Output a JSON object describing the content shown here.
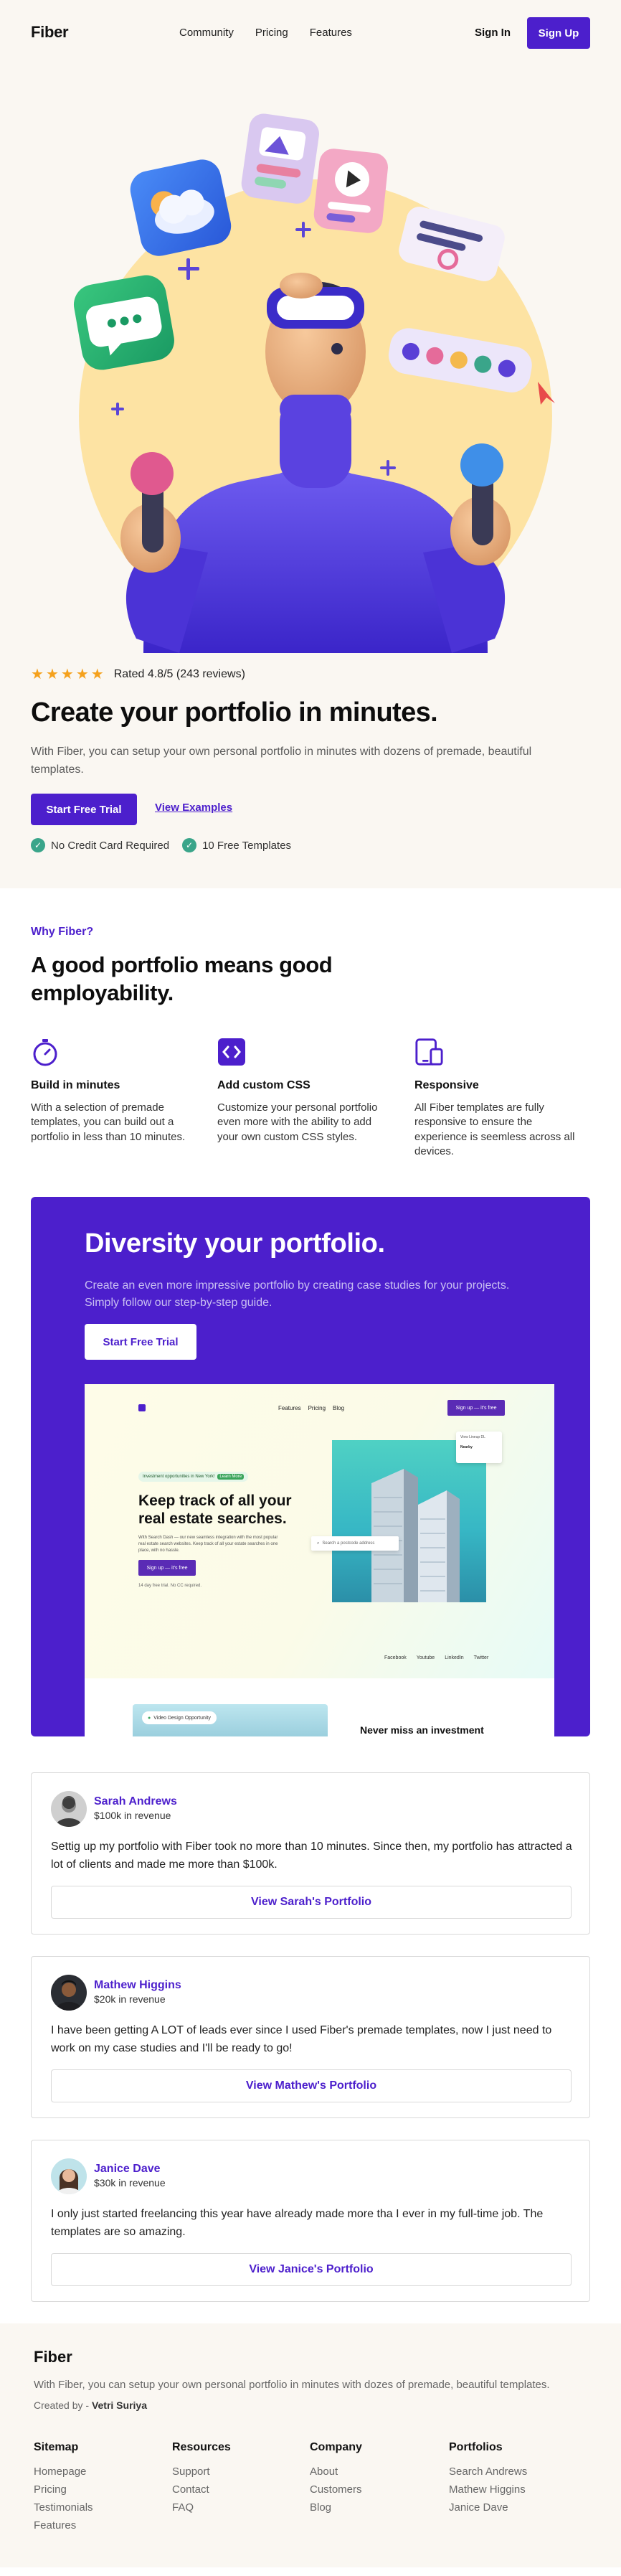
{
  "nav": {
    "logo": "Fiber",
    "links": [
      "Community",
      "Pricing",
      "Features"
    ],
    "sign_in": "Sign In",
    "sign_up": "Sign Up"
  },
  "hero": {
    "stars": 5,
    "rating_text": "Rated 4.8/5 (243 reviews)",
    "title": "Create your portfolio in minutes.",
    "description": "With Fiber, you can setup your own personal portfolio in minutes with dozens of premade, beautiful templates.",
    "primary_button": "Start Free Trial",
    "secondary_link": "View Examples",
    "checks": [
      "No Credit Card Required",
      "10 Free Templates"
    ]
  },
  "why": {
    "eyebrow": "Why Fiber?",
    "title": "A good portfolio means good employability.",
    "features": [
      {
        "title": "Build in minutes",
        "description": "With a selection of premade templates, you can build out a portfolio in less than 10 minutes.",
        "icon": "stopwatch-icon"
      },
      {
        "title": "Add custom CSS",
        "description": "Customize your personal portfolio even more with the ability to add your own custom CSS styles.",
        "icon": "code-icon"
      },
      {
        "title": "Responsive",
        "description": "All Fiber templates are fully responsive to ensure the experience is seemless across all devices.",
        "icon": "devices-icon"
      }
    ]
  },
  "diversity": {
    "title": "Diversity your portfolio.",
    "description": "Create an even more impressive portfolio by creating case studies for your projects. Simply follow our step-by-step guide.",
    "button": "Start Free Trial",
    "mockup": {
      "nav": [
        "Features",
        "Pricing",
        "Blog"
      ],
      "sign_up": "Sign up — it's free",
      "pill_text": "Investment opportunities in New York!",
      "pill_tag": "Learn More",
      "heading": "Keep track of all your real estate searches.",
      "paragraph": "With Search Dash — our new seamless integration with the most popular real estate search websites. Keep track of all your estate searches in one place, with no hassle.",
      "button": "Sign up — it's free",
      "note": "14 day free trial. No CC required.",
      "search_placeholder": "Search a postcode address",
      "float_line1": "View Lineup DL",
      "float_line2": "Nearby",
      "social": [
        "Facebook",
        "Youtube",
        "LinkedIn",
        "Twitter"
      ],
      "bottom_pill": "Video Design Opportunity",
      "bottom_heading": "Never miss an investment"
    }
  },
  "testimonials": [
    {
      "name": "Sarah Andrews",
      "revenue": "$100k in revenue",
      "quote": "Settig up my portfolio with Fiber took no more than 10 minutes. Since then, my portfolio has attracted a lot of clients and made me more than $100k.",
      "button": "View Sarah's Portfolio"
    },
    {
      "name": "Mathew Higgins",
      "revenue": "$20k in revenue",
      "quote": "I have been getting A LOT of leads ever since I used Fiber's premade templates, now I just need to work on my case studies and I'll be ready to go!",
      "button": "View Mathew's Portfolio"
    },
    {
      "name": "Janice Dave",
      "revenue": "$30k in revenue",
      "quote": "I only just started freelancing this year have already made more tha I ever in my full-time job. The templates are so amazing.",
      "button": "View Janice's Portfolio"
    }
  ],
  "footer": {
    "logo": "Fiber",
    "description": "With Fiber, you can setup your own personal portfolio in minutes with dozes of premade, beautiful templates.",
    "created_by_label": "Created by -",
    "created_by_name": "Vetri Suriya",
    "columns": [
      {
        "title": "Sitemap",
        "links": [
          "Homepage",
          "Pricing",
          "Testimonials",
          "Features"
        ]
      },
      {
        "title": "Resources",
        "links": [
          "Support",
          "Contact",
          "FAQ"
        ]
      },
      {
        "title": "Company",
        "links": [
          "About",
          "Customers",
          "Blog"
        ]
      },
      {
        "title": "Portfolios",
        "links": [
          "Search Andrews",
          "Mathew Higgins",
          "Janice Dave"
        ]
      }
    ]
  },
  "colors": {
    "brand": "#4c1fcc",
    "star": "#f5a11c",
    "check": "#3aa58a",
    "hero_bg": "#faf7f2"
  }
}
